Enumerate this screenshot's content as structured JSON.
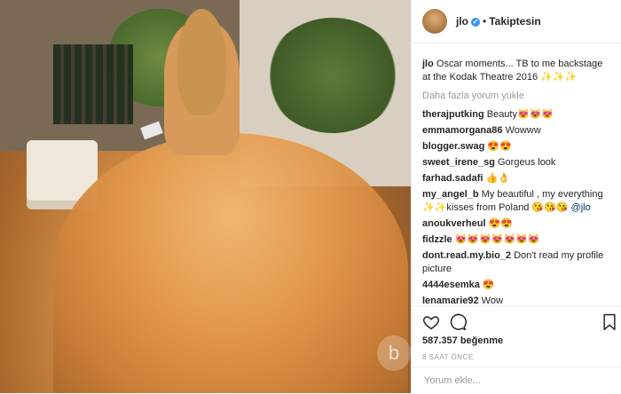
{
  "header": {
    "username": "jlo",
    "verified_icon": "verified-badge-icon",
    "separator": "•",
    "follow_status": "Takiptesin"
  },
  "caption": {
    "username": "jlo",
    "text": "Oscar moments... TB to me backstage at the Kodak Theatre 2016 ✨✨✨"
  },
  "load_more": "Daha fazla yorum yükle",
  "comments": [
    {
      "user": "therajputking",
      "text": "Beauty😻😻😻"
    },
    {
      "user": "emmamorgana86",
      "text": "Wowww"
    },
    {
      "user": "blogger.swag",
      "text": "😍😍"
    },
    {
      "user": "sweet_irene_sg",
      "text": "Gorgeus look"
    },
    {
      "user": "farhad.sadafi",
      "text": "👍👌"
    },
    {
      "user": "my_angel_b",
      "text": "My beautiful , my everything ✨✨kisses from Poland 😘😘😘",
      "mention": "@jlo"
    },
    {
      "user": "anoukverheul",
      "text": "😍😍"
    },
    {
      "user": "fidzzle",
      "text": "😻😻😻😻😻😻😻"
    },
    {
      "user": "dont.read.my.bio_2",
      "text": "Don't read my profile picture"
    },
    {
      "user": "4444esemka",
      "text": "😍"
    },
    {
      "user": "lenamarie92",
      "text": "Wow"
    }
  ],
  "actions": {
    "like_icon": "heart-icon",
    "comment_icon": "comment-bubble-icon",
    "save_icon": "bookmark-icon"
  },
  "likes": "587.357 beğenme",
  "timestamp": "8 SAAT ÖNCE",
  "add_comment_placeholder": "Yorum ekle...",
  "watermark": "b"
}
